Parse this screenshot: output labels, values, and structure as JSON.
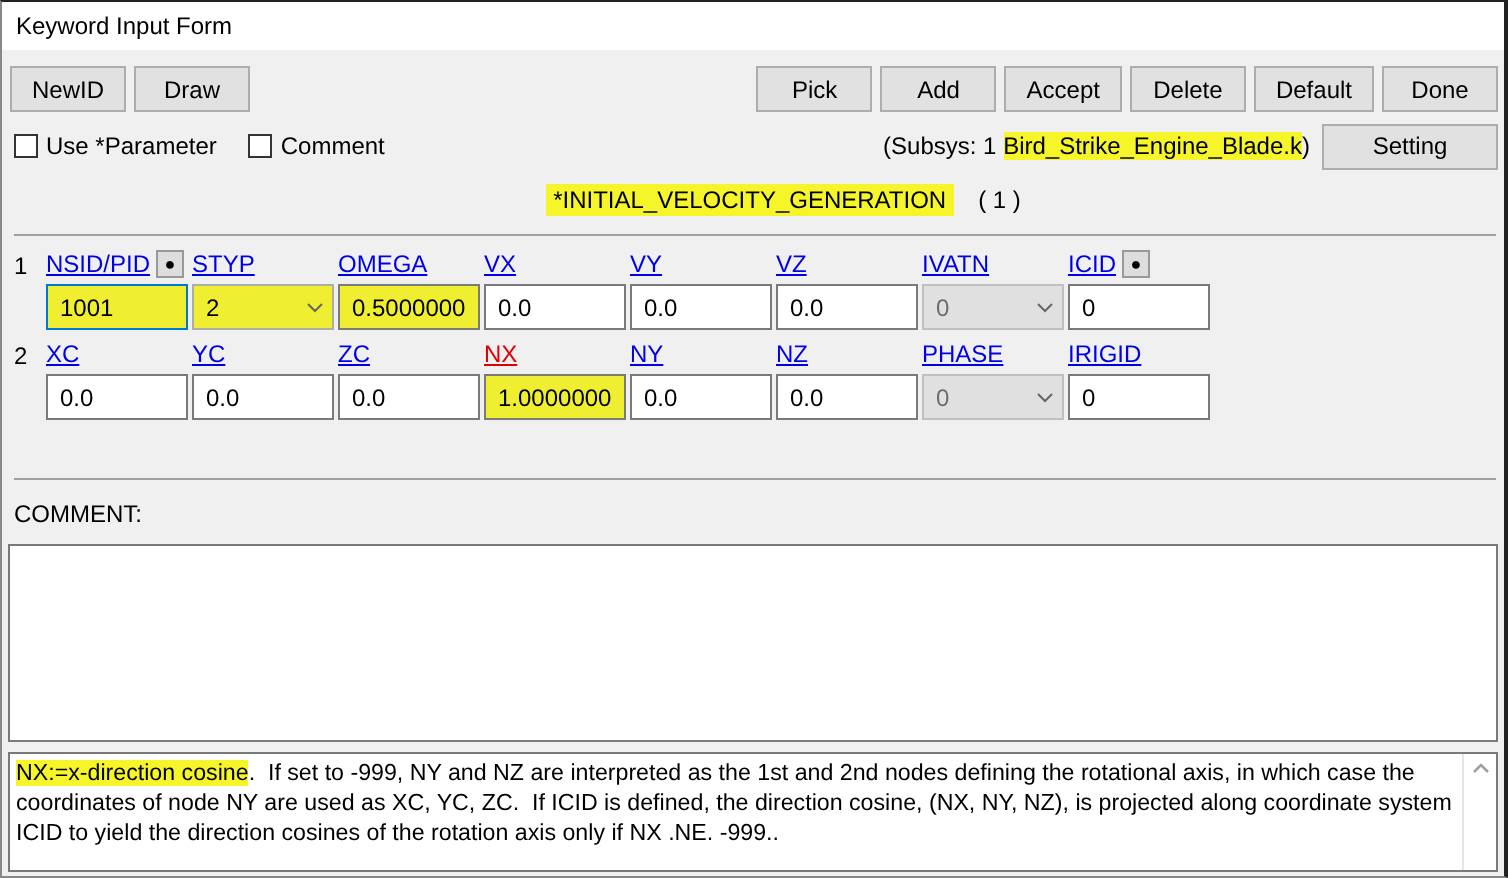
{
  "window": {
    "title": "Keyword Input Form"
  },
  "toolbar": {
    "left": [
      "NewID",
      "Draw"
    ],
    "right": [
      "Pick",
      "Add",
      "Accept",
      "Delete",
      "Default",
      "Done"
    ]
  },
  "options": [
    {
      "label": "Use *Parameter",
      "checked": false
    },
    {
      "label": "Comment",
      "checked": false
    }
  ],
  "subsys": {
    "prefix": "(Subsys: 1 ",
    "file": "Bird_Strike_Engine_Blade.k",
    "suffix": ")",
    "file_highlighted": true,
    "button": "Setting"
  },
  "keyword": {
    "name": "*INITIAL_VELOCITY_GENERATION",
    "highlighted": true,
    "count": "( 1 )"
  },
  "cards": [
    {
      "number": "1",
      "fields": [
        {
          "label": "NSID/PID",
          "kind": "text",
          "value": "1001",
          "highlighted": true,
          "focused": true,
          "active": false,
          "pick": "●"
        },
        {
          "label": "STYP",
          "kind": "select",
          "value": "2",
          "highlighted": true,
          "disabled": false,
          "active": false
        },
        {
          "label": "OMEGA",
          "kind": "text",
          "value": "0.5000000",
          "highlighted": true,
          "focused": false,
          "active": false
        },
        {
          "label": "VX",
          "kind": "text",
          "value": "0.0",
          "highlighted": false,
          "focused": false,
          "active": false
        },
        {
          "label": "VY",
          "kind": "text",
          "value": "0.0",
          "highlighted": false,
          "focused": false,
          "active": false
        },
        {
          "label": "VZ",
          "kind": "text",
          "value": "0.0",
          "highlighted": false,
          "focused": false,
          "active": false
        },
        {
          "label": "IVATN",
          "kind": "select",
          "value": "0",
          "highlighted": false,
          "disabled": true,
          "active": false
        },
        {
          "label": "ICID",
          "kind": "text",
          "value": "0",
          "highlighted": false,
          "focused": false,
          "active": false,
          "pick": "●"
        }
      ]
    },
    {
      "number": "2",
      "fields": [
        {
          "label": "XC",
          "kind": "text",
          "value": "0.0",
          "highlighted": false,
          "focused": false,
          "active": false
        },
        {
          "label": "YC",
          "kind": "text",
          "value": "0.0",
          "highlighted": false,
          "focused": false,
          "active": false
        },
        {
          "label": "ZC",
          "kind": "text",
          "value": "0.0",
          "highlighted": false,
          "focused": false,
          "active": false
        },
        {
          "label": "NX",
          "kind": "text",
          "value": "1.0000000",
          "highlighted": true,
          "focused": false,
          "active": true
        },
        {
          "label": "NY",
          "kind": "text",
          "value": "0.0",
          "highlighted": false,
          "focused": false,
          "active": false
        },
        {
          "label": "NZ",
          "kind": "text",
          "value": "0.0",
          "highlighted": false,
          "focused": false,
          "active": false
        },
        {
          "label": "PHASE",
          "kind": "select",
          "value": "0",
          "highlighted": false,
          "disabled": true,
          "active": false
        },
        {
          "label": "IRIGID",
          "kind": "text",
          "value": "0",
          "highlighted": false,
          "focused": false,
          "active": false
        }
      ]
    }
  ],
  "comment": {
    "label": "COMMENT:"
  },
  "help": {
    "lead": "NX:=x-direction cosine",
    "lead_highlighted": true,
    "text": ".  If set to -999, NY and NZ are interpreted as the 1st and 2nd nodes defining the rotational axis, in which case the coordinates of node NY are used as XC, YC, ZC.  If ICID is defined, the direction cosine, (NX, NY, NZ), is projected along coordinate system ICID to yield the direction cosines of the rotation axis only if NX .NE. -999.."
  }
}
